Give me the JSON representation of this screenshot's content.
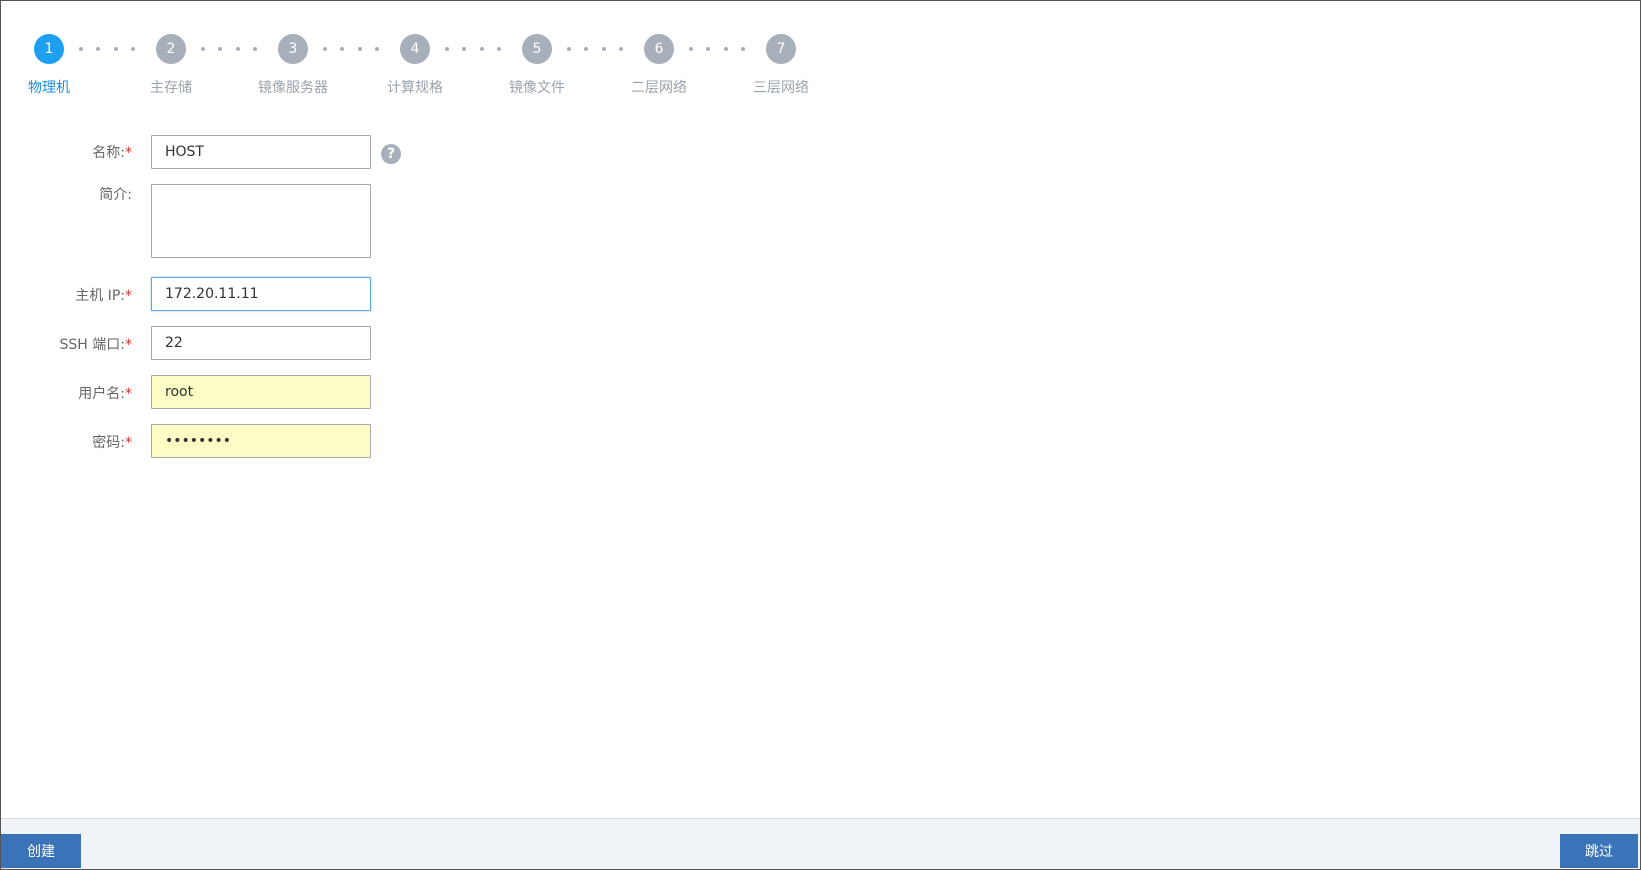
{
  "wizard": {
    "steps": [
      {
        "number": "1",
        "label": "物理机"
      },
      {
        "number": "2",
        "label": "主存储"
      },
      {
        "number": "3",
        "label": "镜像服务器"
      },
      {
        "number": "4",
        "label": "计算规格"
      },
      {
        "number": "5",
        "label": "镜像文件"
      },
      {
        "number": "6",
        "label": "二层网络"
      },
      {
        "number": "7",
        "label": "三层网络"
      }
    ],
    "active_step": "1"
  },
  "form": {
    "name": {
      "label": "名称:",
      "required_mark": "*",
      "value": "HOST"
    },
    "description": {
      "label": "简介:",
      "value": ""
    },
    "host_ip": {
      "label": "主机 IP:",
      "required_mark": "*",
      "value": "172.20.11.11"
    },
    "ssh_port": {
      "label": "SSH 端口:",
      "required_mark": "*",
      "value": "22"
    },
    "username": {
      "label": "用户名:",
      "required_mark": "*",
      "value": "root"
    },
    "password": {
      "label": "密码:",
      "required_mark": "*",
      "value": "••••••••"
    },
    "help_icon": "question-circle-icon"
  },
  "footer": {
    "create_label": "创建",
    "skip_label": "跳过"
  },
  "colors": {
    "active_step": "#1e9fef",
    "inactive_step": "#a7afba",
    "required": "#e03030",
    "button": "#3b73b9",
    "autofill": "#fbfdc4",
    "footer_bg": "#f0f3f7"
  }
}
